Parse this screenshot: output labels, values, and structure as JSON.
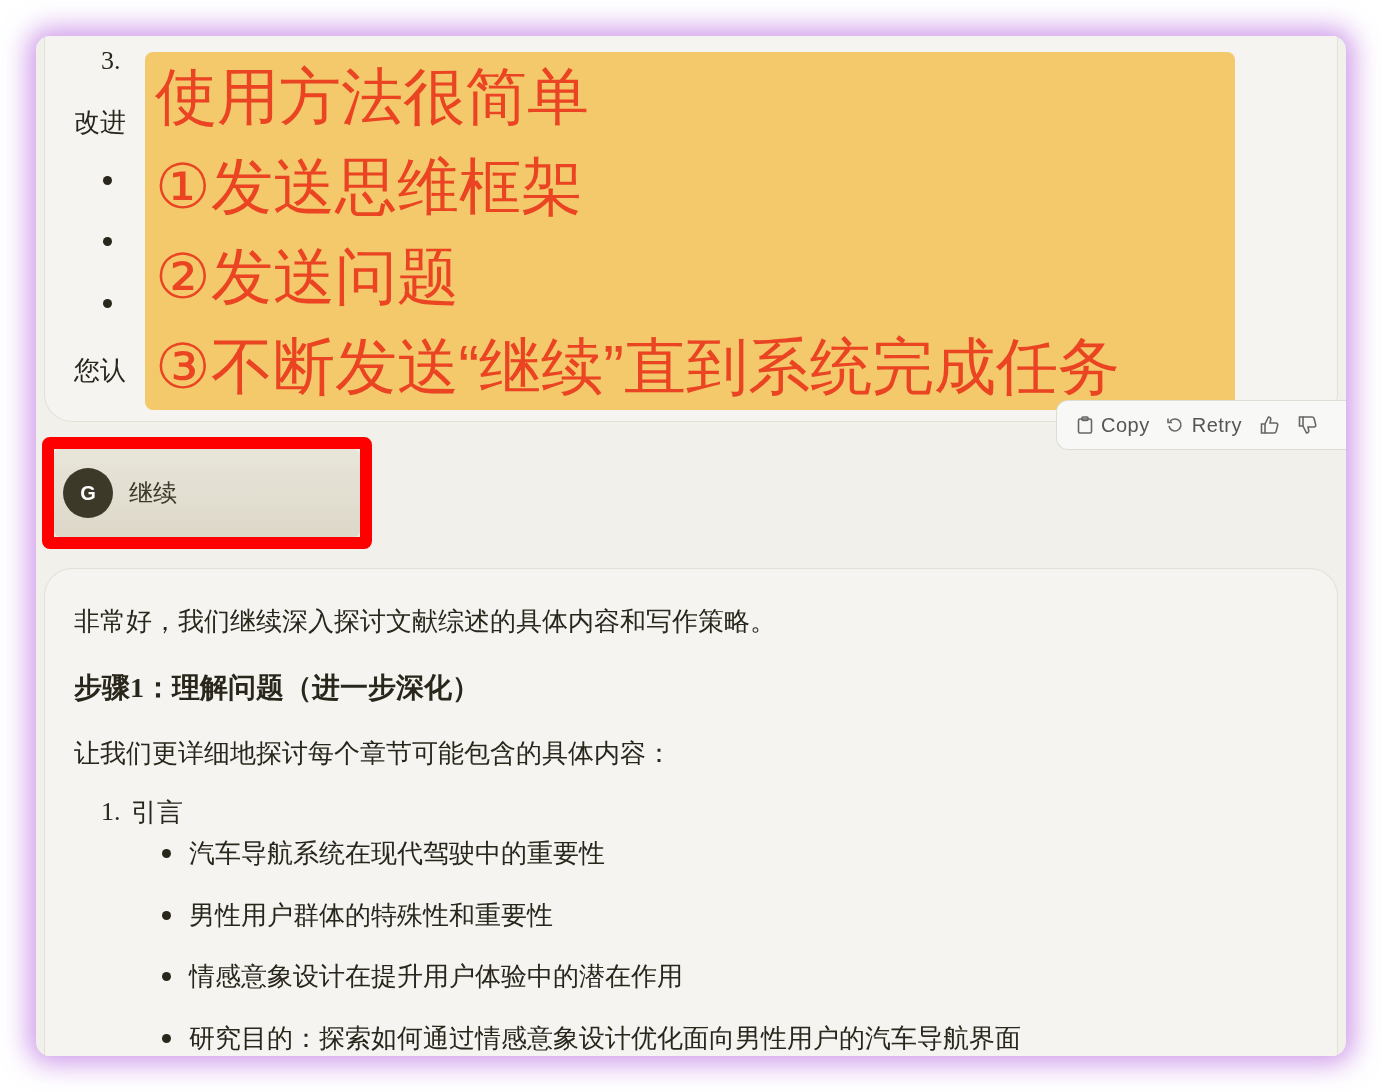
{
  "previous_reply": {
    "list_item": {
      "number": "3."
    },
    "lead": "改进",
    "bullets": [
      {
        "kind": "bullet"
      },
      {
        "kind": "bullet"
      },
      {
        "kind": "bullet"
      }
    ],
    "closing": "您认"
  },
  "annotation": {
    "lines": [
      "使用方法很简单",
      "①发送思维框架",
      "②发送问题",
      "③不断发送“继续”直到系统完成任务"
    ]
  },
  "actions": [
    {
      "kind": "copy",
      "label": "Copy"
    },
    {
      "kind": "retry",
      "label": "Retry"
    },
    {
      "kind": "thumbs_up"
    },
    {
      "kind": "thumbs_down"
    }
  ],
  "user_message": {
    "avatar": "G",
    "text": "继续",
    "highlighted": true
  },
  "reply": {
    "intro": "非常好，我们继续深入探讨文献综述的具体内容和写作策略。",
    "heading": "步骤1：理解问题（进一步深化）",
    "lead": "让我们更详细地探讨每个章节可能包含的具体内容：",
    "sections": [
      {
        "number": "1.",
        "title": "引言",
        "points": [
          "汽车导航系统在现代驾驶中的重要性",
          "男性用户群体的特殊性和重要性",
          "情感意象设计在提升用户体验中的潜在作用",
          "研究目的：探索如何通过情感意象设计优化面向男性用户的汽车导航界面"
        ]
      }
    ]
  }
}
